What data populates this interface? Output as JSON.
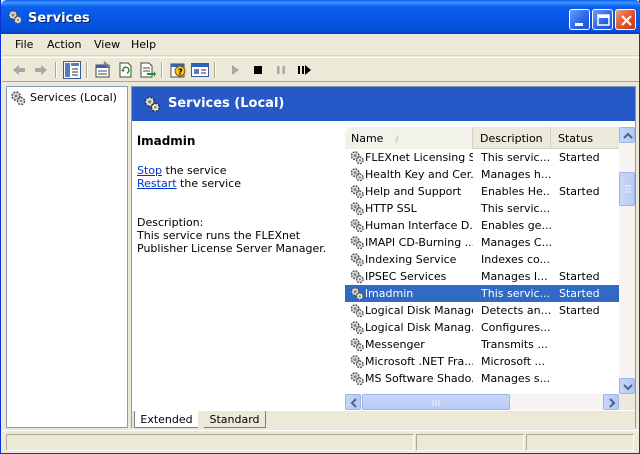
{
  "window": {
    "title": "Services"
  },
  "menu": [
    {
      "id": "file",
      "label": "File"
    },
    {
      "id": "action",
      "label": "Action"
    },
    {
      "id": "view",
      "label": "View"
    },
    {
      "id": "help",
      "label": "Help"
    }
  ],
  "tree": {
    "root_label": "Services (Local)"
  },
  "panel": {
    "title": "Services (Local)"
  },
  "detail": {
    "service_name": "lmadmin",
    "stop_link": "Stop",
    "stop_suffix": " the service",
    "restart_link": "Restart",
    "restart_suffix": " the service",
    "description_label": "Description:",
    "description_text": "This service runs the FLEXnet Publisher License Server Manager."
  },
  "columns": {
    "name": "Name",
    "sort_indicator": "/",
    "description": "Description",
    "status": "Status"
  },
  "services": [
    {
      "name": "FLEXnet Licensing S...",
      "description": "This servic...",
      "status": "Started",
      "selected": false
    },
    {
      "name": "Health Key and Cer...",
      "description": "Manages h...",
      "status": "",
      "selected": false
    },
    {
      "name": "Help and Support",
      "description": "Enables He...",
      "status": "Started",
      "selected": false
    },
    {
      "name": "HTTP SSL",
      "description": "This servic...",
      "status": "",
      "selected": false
    },
    {
      "name": "Human Interface D...",
      "description": "Enables ge...",
      "status": "",
      "selected": false
    },
    {
      "name": "IMAPI CD-Burning ...",
      "description": "Manages C...",
      "status": "",
      "selected": false
    },
    {
      "name": "Indexing Service",
      "description": "Indexes co...",
      "status": "",
      "selected": false
    },
    {
      "name": "IPSEC Services",
      "description": "Manages I...",
      "status": "Started",
      "selected": false
    },
    {
      "name": "lmadmin",
      "description": "This servic...",
      "status": "Started",
      "selected": true
    },
    {
      "name": "Logical Disk Manager",
      "description": "Detects an...",
      "status": "Started",
      "selected": false
    },
    {
      "name": "Logical Disk Manag...",
      "description": "Configures...",
      "status": "",
      "selected": false
    },
    {
      "name": "Messenger",
      "description": "Transmits ...",
      "status": "",
      "selected": false
    },
    {
      "name": "Microsoft .NET Fra...",
      "description": "Microsoft ...",
      "status": "",
      "selected": false
    },
    {
      "name": "MS Software Shado...",
      "description": "Manages s...",
      "status": "",
      "selected": false
    }
  ],
  "tabs": [
    {
      "id": "extended",
      "label": "Extended",
      "active": true
    },
    {
      "id": "standard",
      "label": "Standard",
      "active": false
    }
  ],
  "colors": {
    "title_bar": "#0554e3",
    "header_band": "#2758c8",
    "selection": "#316ac5",
    "link": "#0033cc"
  }
}
